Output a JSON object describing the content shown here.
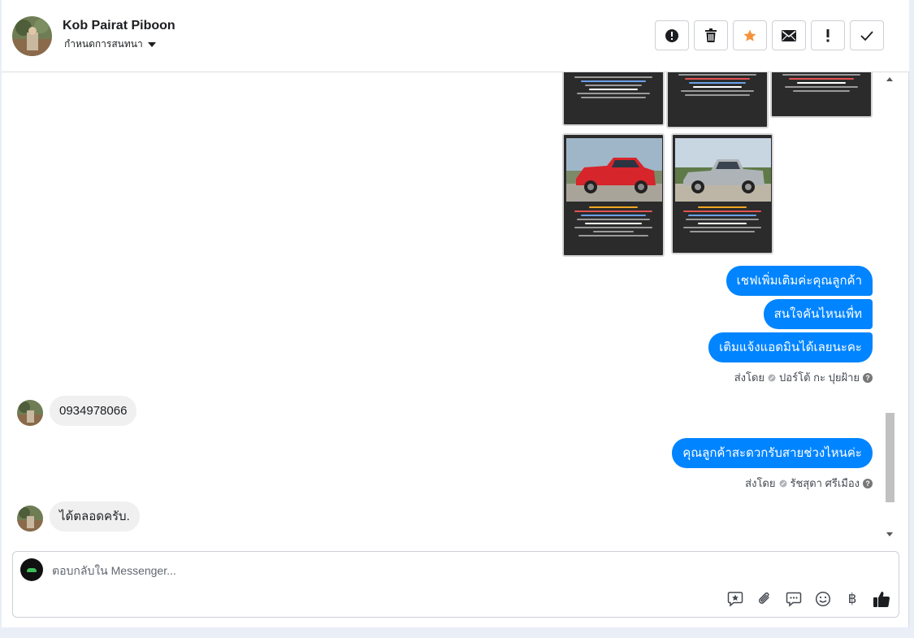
{
  "header": {
    "contact_name": "Kob Pairat Piboon",
    "assign_label": "กำหนดการสนทนา"
  },
  "action_icons": [
    "alert-circle-icon",
    "trash-icon",
    "star-icon",
    "envelope-icon",
    "exclamation-icon",
    "check-icon"
  ],
  "colors": {
    "accent": "#0084ff",
    "star": "#f7923b",
    "incoming": "#f0f0f0"
  },
  "messages": {
    "out1": [
      "เชฟเพิ่มเติมค่ะคุณลูกค้า",
      "สนใจคันไหนเพื่ท",
      "เติมแจ้งแอดมินได้เลยนะคะ"
    ],
    "sender1_prefix": "ส่งโดย",
    "sender1_name": "ปอร์โต้ กะ ปุยฝ้าย",
    "in1": "0934978066",
    "out2": "คุณลูกค้าสะดวกรับสายช่วงไหนค่ะ",
    "sender2_prefix": "ส่งโดย",
    "sender2_name": "รัชสุดา ศรีเมือง",
    "in2": "ได้ตลอดครับ."
  },
  "composer": {
    "placeholder": "ตอบกลับใน Messenger...",
    "baht_symbol": "฿"
  }
}
